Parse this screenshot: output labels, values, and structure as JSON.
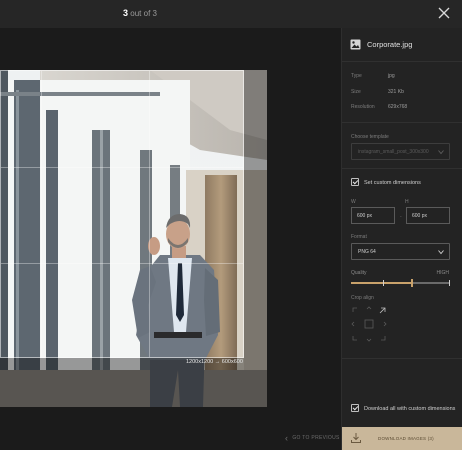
{
  "header": {
    "current": "3",
    "of_total": "out of 3"
  },
  "image": {
    "crop_dimensions": "1200x1200 → 600x600"
  },
  "nav": {
    "previous_label": "GO TO PREVIOUS"
  },
  "sidebar": {
    "file_name": "Corporate.jpg",
    "meta": [
      {
        "label": "Type",
        "value": "jpg"
      },
      {
        "label": "Size",
        "value": "321 Kb"
      },
      {
        "label": "Resolution",
        "value": "629x768"
      }
    ],
    "template_label": "Choose template",
    "template_placeholder": "instagram_small_post_300x300",
    "custom_dims_label": "Set custom dimensions",
    "width_label": "W",
    "height_label": "H",
    "width_value": "600 px",
    "height_value": "600 px",
    "format_label": "Format",
    "format_value": "PNG 64",
    "quality_label": "Quality",
    "quality_level": "HIGH",
    "quality_fraction": 0.62,
    "crop_align_label": "Crop align",
    "download_all_label": "Download all with custom dimensions",
    "download_button": "DOWNLOAD IMAGES (3)"
  },
  "colors": {
    "accent": "#c9a26b",
    "download_bg": "#c9b79a"
  }
}
